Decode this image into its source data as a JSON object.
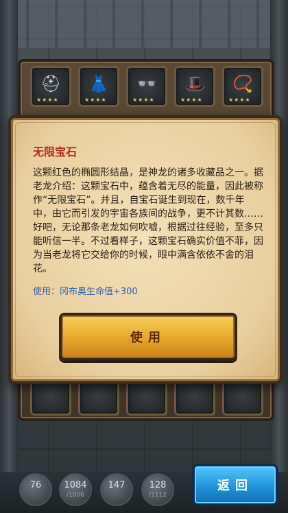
{
  "inventory": {
    "top_row": [
      {
        "icon": "helmet-icon",
        "glyph": "⛑",
        "stars": "★★★★"
      },
      {
        "icon": "dress-icon",
        "glyph": "👗",
        "stars": "★★★★"
      },
      {
        "icon": "glasses-icon",
        "glyph": "👓",
        "stars": "★★★★"
      },
      {
        "icon": "hat-icon",
        "glyph": "🎩",
        "stars": "★★★★"
      },
      {
        "icon": "necklace-icon",
        "glyph": "📿",
        "stars": "★★★★"
      }
    ]
  },
  "dialog": {
    "title": "无限宝石",
    "description": "这颗红色的椭圆形结晶，是神龙的诸多收藏品之一。据老龙介绍：这颗宝石中，蕴含着无尽的能量，因此被称作“无限宝石”。并且，自宝石诞生到现在，数千年中，由它而引发的宇宙各族间的战争，更不计其数……好吧，无论那条老龙如何吹嘘，根据过往经验，至多只能听信一半。不过看样子，这颗宝石确实价值不菲，因为当老龙将它交给你的时候，眼中满含依依不舍的泪花。",
    "use_info": "使用：冈布奥生命值+300",
    "use_button": "使用"
  },
  "stats": [
    {
      "value": "76",
      "sub": ""
    },
    {
      "value": "1084",
      "sub": "/1006"
    },
    {
      "value": "147",
      "sub": ""
    },
    {
      "value": "128",
      "sub": "/1112"
    }
  ],
  "back_button": "返回"
}
